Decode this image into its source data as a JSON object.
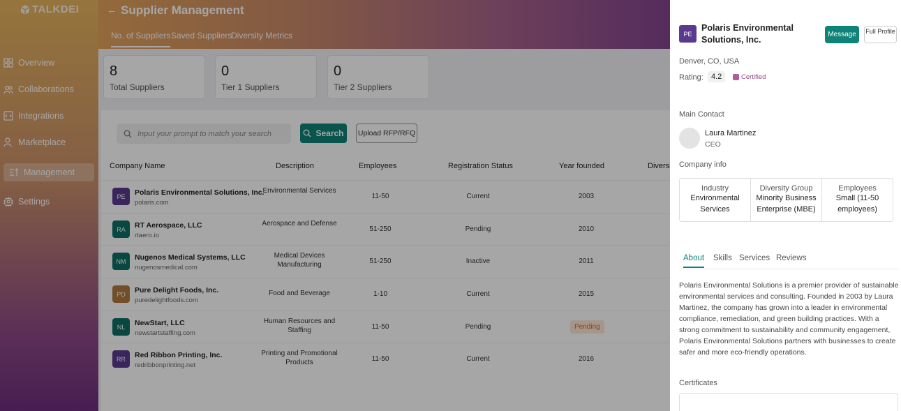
{
  "app": {
    "logo": "TALKDEI",
    "nav": [
      {
        "label": "Overview",
        "icon": "grid-icon"
      },
      {
        "label": "Collaborations",
        "icon": "users-icon"
      },
      {
        "label": "Integrations",
        "icon": "code-icon"
      },
      {
        "label": "Marketplace",
        "icon": "user-icon"
      },
      {
        "label": "Management",
        "icon": "sort-icon",
        "active": true
      },
      {
        "label": "Settings",
        "icon": "gear-icon"
      }
    ]
  },
  "header": {
    "title": "Supplier Management",
    "tabs": [
      "No. of Suppliers",
      "Saved Suppliers",
      "Diversity Metrics"
    ]
  },
  "stats": [
    {
      "value": "8",
      "label": "Total Suppliers"
    },
    {
      "value": "0",
      "label": "Tier 1 Suppliers"
    },
    {
      "value": "0",
      "label": "Tier 2 Suppliers"
    }
  ],
  "search": {
    "placeholder": "Input your prompt to match your search",
    "button": "Search",
    "upload": "Upload RFP/RFQ"
  },
  "table": {
    "columns": [
      "Company Name",
      "Description",
      "Employees",
      "Registration Status",
      "Year founded",
      "Diversi"
    ],
    "rows": [
      {
        "initials": "PE",
        "color": "#5a3a8e",
        "name": "Polaris Environmental Solutions, Inc.",
        "domain": "polaris.com",
        "desc": "Environmental Services",
        "employees": "11-50",
        "status": "Current",
        "year": "2003"
      },
      {
        "initials": "RA",
        "color": "#0e6e66",
        "name": "RT Aerospace, LLC",
        "domain": "rtaero.io",
        "desc": "Aerospace and Defense",
        "employees": "51-250",
        "status": "Pending",
        "year": "2010"
      },
      {
        "initials": "NM",
        "color": "#0e6e66",
        "name": "Nugenos Medical Systems, LLC",
        "domain": "nugenosmedical.com",
        "desc": "Medical Devices Manufacturing",
        "employees": "51-250",
        "status": "Inactive",
        "year": "2011"
      },
      {
        "initials": "PD",
        "color": "#b07a3e",
        "name": "Pure Delight Foods, Inc.",
        "domain": "puredelightfoods.com",
        "desc": "Food and Beverage",
        "employees": "1-10",
        "status": "Current",
        "year": "2015"
      },
      {
        "initials": "NL",
        "color": "#0e6e66",
        "name": "NewStart, LLC",
        "domain": "newstartstaffing.com",
        "desc": "Human Resources and Staffing",
        "employees": "11-50",
        "status": "Pending",
        "year": "",
        "badge": "Pending"
      },
      {
        "initials": "RR",
        "color": "#5a3a8e",
        "name": "Red Ribbon Printing, Inc.",
        "domain": "redribbonprinting.net",
        "desc": "Printing and Promotional Products",
        "employees": "11-50",
        "status": "Current",
        "year": "2016"
      }
    ]
  },
  "drawer": {
    "initials": "PE",
    "name": "Polaris Environmental Solutions, Inc.",
    "message_btn": "Message",
    "full_profile_btn": "Full Profile",
    "location": "Denver, CO, USA",
    "rating_label": "Rating:",
    "rating": "4.2",
    "certified": "Certified",
    "main_contact_label": "Main Contact",
    "contact_name": "Laura Martinez",
    "contact_role": "CEO",
    "company_info_label": "Company info",
    "info": [
      {
        "h": "Industry",
        "v": "Environmental Services"
      },
      {
        "h": "Diversity Group",
        "v": "Minority Business Enterprise (MBE)"
      },
      {
        "h": "Employees",
        "v": "Small (11-50 employees)"
      }
    ],
    "tabs": [
      "About",
      "Skills",
      "Services",
      "Reviews"
    ],
    "about": "Polaris Environmental Solutions is a premier provider of sustainable environmental services and consulting. Founded in 2003 by Laura Martinez, the company has grown into a leader in environmental compliance, remediation, and green building practices. With a strong commitment to sustainability and community engagement, Polaris Environmental Solutions partners with businesses to create safer and more eco-friendly operations.",
    "certificates_label": "Certificates"
  }
}
